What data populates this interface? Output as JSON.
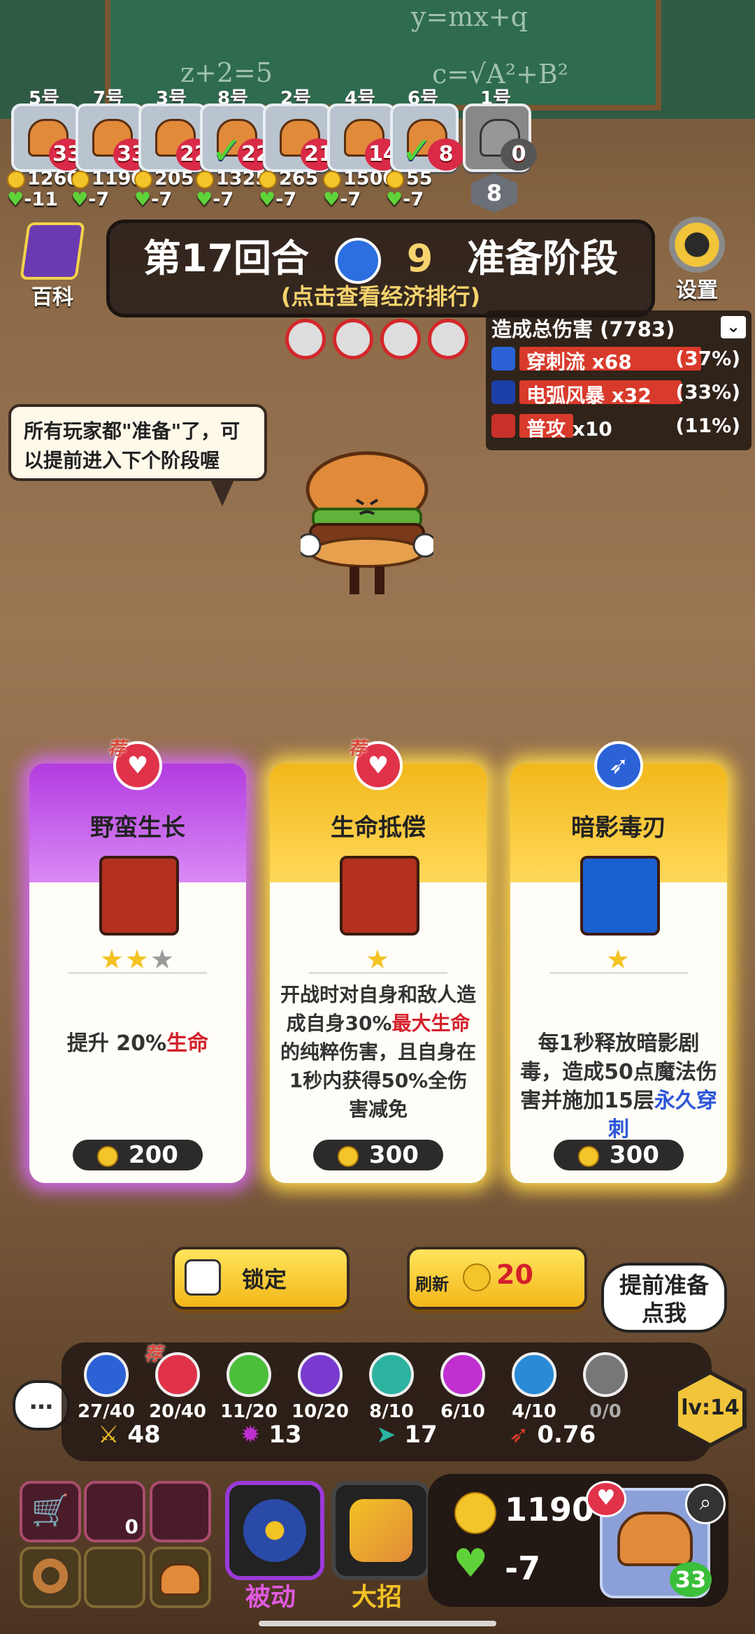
{
  "board": {
    "formula1": "y=mx+q",
    "formula2": "z+2=5",
    "formula3": "c=√A²+B²"
  },
  "players": [
    {
      "num": "5号",
      "hp": "33",
      "gold": "1260",
      "life": "-11",
      "ready": false
    },
    {
      "num": "7号",
      "hp": "33",
      "gold": "1190",
      "life": "-7",
      "ready": false
    },
    {
      "num": "3号",
      "hp": "22",
      "gold": "205",
      "life": "-7",
      "ready": false
    },
    {
      "num": "8号",
      "hp": "22",
      "gold": "1325",
      "life": "-7",
      "ready": true
    },
    {
      "num": "2号",
      "hp": "21",
      "gold": "265",
      "life": "-7",
      "ready": false
    },
    {
      "num": "4号",
      "hp": "14",
      "gold": "1500",
      "life": "-7",
      "ready": false
    },
    {
      "num": "6号",
      "hp": "8",
      "gold": "55",
      "life": "-7",
      "ready": true
    },
    {
      "num": "1号",
      "hp": "0",
      "gold": "",
      "life": "",
      "ready": false,
      "eliminated_rank": "8"
    }
  ],
  "header": {
    "encyclopedia_label": "百科",
    "settings_label": "设置",
    "round_text": "第17回合",
    "timer": "9",
    "phase": "准备阶段",
    "subtitle": "(点击查看经济排行)"
  },
  "damage_panel": {
    "title": "造成总伤害 (7783)",
    "rows": [
      {
        "name": "穿刺流 x68",
        "pct": "(37%)",
        "color": "#2b62d6",
        "bar": 0.37
      },
      {
        "name": "电弧风暴 x32",
        "pct": "(33%)",
        "color": "#1d3fa8",
        "bar": 0.33
      },
      {
        "name": "普攻 x10",
        "pct": "(11%)",
        "color": "#c8322a",
        "bar": 0.11
      }
    ]
  },
  "bubble": {
    "text": "所有玩家都\"准备\"了，可以提前进入下个阶段喔"
  },
  "cards": [
    {
      "rec": "荐",
      "title": "野蛮生长",
      "stars": "★★★",
      "filled": 2,
      "desc_parts": [
        {
          "t": "提升 20%",
          "c": ""
        },
        {
          "t": "生命",
          "c": "red"
        }
      ],
      "price": "200",
      "theme": "#b33be0"
    },
    {
      "rec": "荐",
      "title": "生命抵偿",
      "stars": "★",
      "filled": 1,
      "desc_parts": [
        {
          "t": "开战时对自身和敌人造成自身30%",
          "c": ""
        },
        {
          "t": "最大生命",
          "c": "red"
        },
        {
          "t": "的纯粹伤害，且自身在1秒内获得50%全伤害减免",
          "c": ""
        }
      ],
      "price": "300",
      "theme": "#f2b81c"
    },
    {
      "rec": "",
      "title": "暗影毒刃",
      "stars": "★",
      "filled": 1,
      "desc_parts": [
        {
          "t": "每1秒释放暗影剧毒，造成50点魔法伤害并施加15层",
          "c": ""
        },
        {
          "t": "永久穿刺",
          "c": "blue"
        }
      ],
      "price": "300",
      "theme": "#f2b81c"
    }
  ],
  "actions": {
    "lock_label": "锁定",
    "refresh_label": "刷新",
    "refresh_cost": "20",
    "ready_early_line1": "提前准备",
    "ready_early_line2": "点我"
  },
  "stats": [
    {
      "value": "27/40",
      "color": "#2b62d6",
      "rec": ""
    },
    {
      "value": "20/40",
      "color": "#e0334a",
      "rec": "荐"
    },
    {
      "value": "11/20",
      "color": "#4bbf3a",
      "rec": ""
    },
    {
      "value": "10/20",
      "color": "#7a3ad0",
      "rec": ""
    },
    {
      "value": "8/10",
      "color": "#2bb3a0",
      "rec": ""
    },
    {
      "value": "6/10",
      "color": "#c02fd0",
      "rec": ""
    },
    {
      "value": "4/10",
      "color": "#2a8ad8",
      "rec": ""
    },
    {
      "value": "0/0",
      "color": "#777777",
      "rec": ""
    }
  ],
  "attributes": {
    "attack": "48",
    "skill": "13",
    "speed": "17",
    "crit": "0.76"
  },
  "level": "lv:14",
  "skills": {
    "passive_label": "被动",
    "ultimate_label": "大招"
  },
  "slots": {
    "tank_count": "0"
  },
  "wallet": {
    "gold": "1190",
    "life": "-7",
    "hp": "33"
  }
}
